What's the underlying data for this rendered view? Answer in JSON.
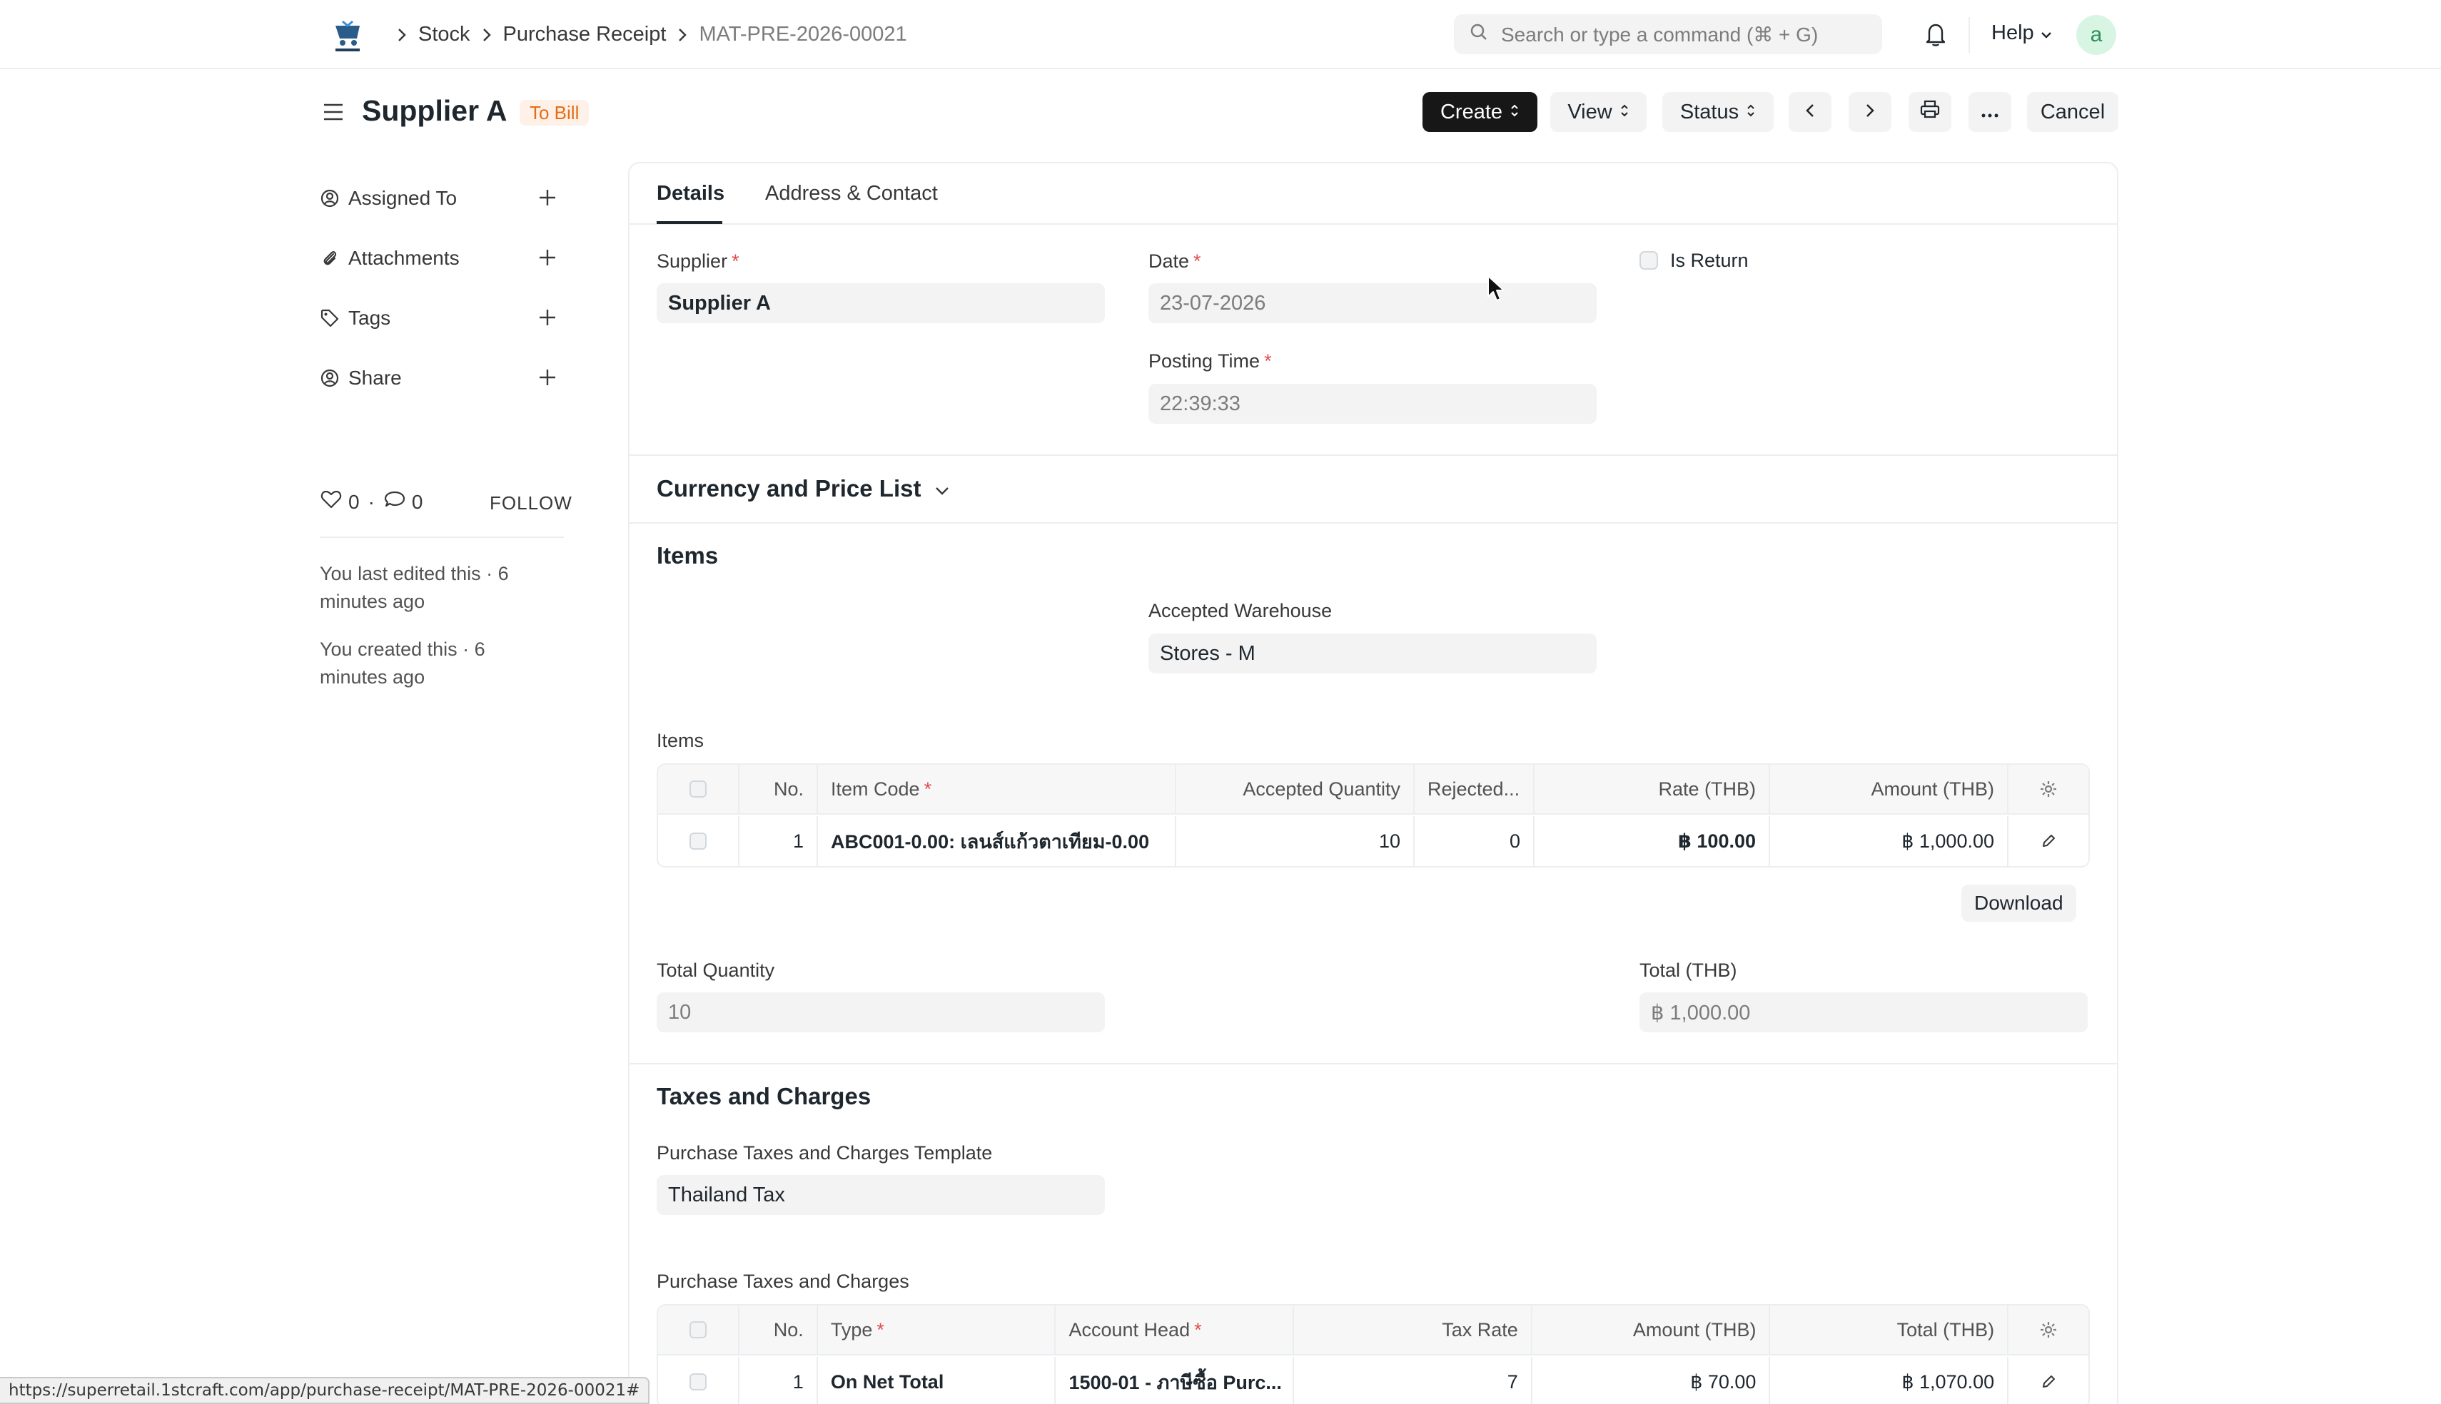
{
  "navbar": {
    "breadcrumbs": [
      "Stock",
      "Purchase Receipt",
      "MAT-PRE-2026-00021"
    ],
    "search_placeholder": "Search or type a command (⌘ + G)",
    "help_label": "Help",
    "avatar_letter": "a"
  },
  "page_head": {
    "title": "Supplier A",
    "status": "To Bill",
    "status_color": "#e86c13",
    "buttons": {
      "create": "Create",
      "view": "View",
      "status": "Status",
      "cancel": "Cancel"
    }
  },
  "sidebar": {
    "items": [
      {
        "label": "Assigned To",
        "icon": "assign-icon"
      },
      {
        "label": "Attachments",
        "icon": "paperclip-icon"
      },
      {
        "label": "Tags",
        "icon": "tag-icon"
      },
      {
        "label": "Share",
        "icon": "share-icon"
      }
    ],
    "likes": "0",
    "comments": "0",
    "follow": "FOLLOW",
    "activity": [
      "You last edited this · 6 minutes ago",
      "You created this · 6 minutes ago"
    ]
  },
  "tabs": [
    "Details",
    "Address & Contact"
  ],
  "details": {
    "supplier_label": "Supplier",
    "supplier_value": "Supplier A",
    "date_label": "Date",
    "date_value": "23-07-2026",
    "posting_time_label": "Posting Time",
    "posting_time_value": "22:39:33",
    "is_return_label": "Is Return"
  },
  "currency_section": {
    "title": "Currency and Price List"
  },
  "items_section": {
    "title": "Items",
    "warehouse_label": "Accepted Warehouse",
    "warehouse_value": "Stores - M",
    "table_label": "Items",
    "columns": [
      "No.",
      "Item Code",
      "Accepted Quantity",
      "Rejected...",
      "Rate (THB)",
      "Amount (THB)"
    ],
    "rows": [
      {
        "no": "1",
        "item_code": "ABC001-0.00: เลนส์แก้วตาเทียม-0.00",
        "accepted_qty": "10",
        "rejected": "0",
        "rate": "฿ 100.00",
        "amount": "฿ 1,000.00"
      }
    ],
    "download_label": "Download",
    "total_qty_label": "Total Quantity",
    "total_qty_value": "10",
    "total_label": "Total (THB)",
    "total_value": "฿ 1,000.00"
  },
  "taxes_section": {
    "title": "Taxes and Charges",
    "template_label": "Purchase Taxes and Charges Template",
    "template_value": "Thailand Tax",
    "table_label": "Purchase Taxes and Charges",
    "columns": [
      "No.",
      "Type",
      "Account Head",
      "Tax Rate",
      "Amount (THB)",
      "Total (THB)"
    ],
    "rows": [
      {
        "no": "1",
        "type": "On Net Total",
        "account_head": "1500-01 - ภาษีซื้อ Purc...",
        "tax_rate": "7",
        "amount": "฿ 70.00",
        "total": "฿ 1,070.00"
      }
    ]
  },
  "status_bar_url": "https://superretail.1stcraft.com/app/purchase-receipt/MAT-PRE-2026-00021#"
}
